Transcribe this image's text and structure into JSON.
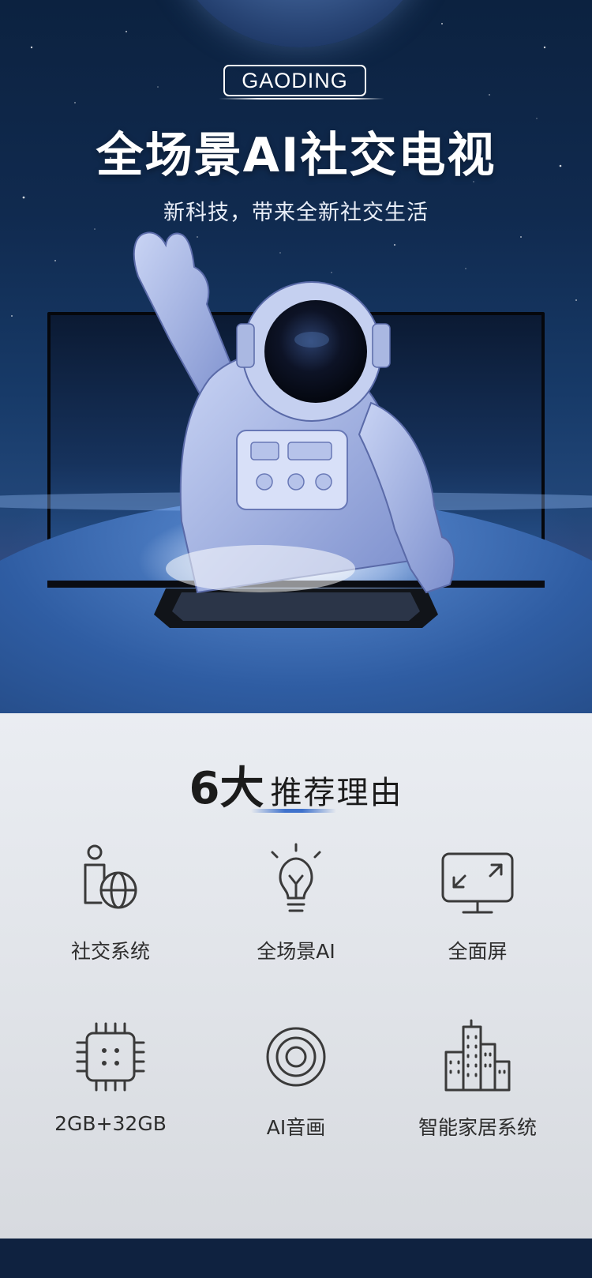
{
  "hero": {
    "brand": "GAODING",
    "title": "全场景AI社交电视",
    "subtitle": "新科技，带来全新社交生活"
  },
  "reasons": {
    "title_number": "6大",
    "title_text": "推荐理由",
    "items": [
      {
        "label": "社交系统",
        "icon": "person-globe-icon"
      },
      {
        "label": "全场景AI",
        "icon": "lightbulb-icon"
      },
      {
        "label": "全面屏",
        "icon": "fullscreen-monitor-icon"
      },
      {
        "label": "2GB+32GB",
        "icon": "chip-icon"
      },
      {
        "label": "AI音画",
        "icon": "concentric-circles-icon"
      },
      {
        "label": "智能家居系统",
        "icon": "buildings-icon"
      }
    ]
  },
  "colors": {
    "hero_top": "#0c2240",
    "hero_bottom": "#252a53",
    "accent_blue": "#3f72cc",
    "footer": "#0f2240"
  }
}
